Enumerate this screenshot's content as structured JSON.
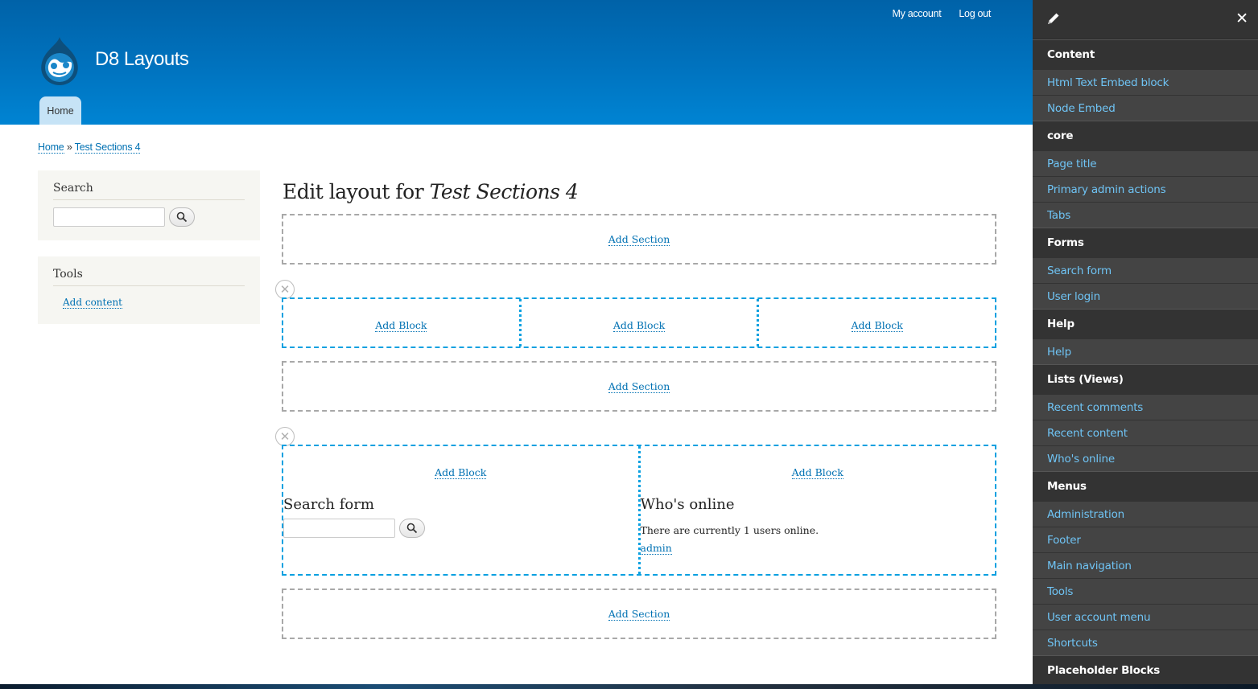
{
  "header": {
    "site_name": "D8 Layouts",
    "secondary_menu": [
      "My account",
      "Log out"
    ],
    "main_menu": [
      "Home"
    ]
  },
  "breadcrumb": {
    "home": "Home",
    "separator": "»",
    "current": "Test Sections 4"
  },
  "sidebar": {
    "search_title": "Search",
    "tools_title": "Tools",
    "tools_link": "Add content"
  },
  "main": {
    "title_prefix": "Edit layout for",
    "title_node": "Test Sections 4",
    "add_section": "Add Section",
    "add_block": "Add Block",
    "remove_symbol": "✕",
    "search_form_title": "Search form",
    "whos_online_title": "Who's online",
    "whos_online_text": "There are currently 1 users online.",
    "whos_online_user": "admin"
  },
  "panel": {
    "close_symbol": "✕",
    "categories": [
      {
        "title": "Content",
        "items": [
          "Html Text Embed block",
          "Node Embed"
        ]
      },
      {
        "title": "core",
        "items": [
          "Page title",
          "Primary admin actions",
          "Tabs"
        ]
      },
      {
        "title": "Forms",
        "items": [
          "Search form",
          "User login"
        ]
      },
      {
        "title": "Help",
        "items": [
          "Help"
        ]
      },
      {
        "title": "Lists (Views)",
        "items": [
          "Recent comments",
          "Recent content",
          "Who's online"
        ]
      },
      {
        "title": "Menus",
        "items": [
          "Administration",
          "Footer",
          "Main navigation",
          "Tools",
          "User account menu",
          "Shortcuts"
        ]
      },
      {
        "title": "Placeholder Blocks",
        "items": []
      }
    ]
  },
  "colors": {
    "link": "#0071b3",
    "header_blue": "#0073bf",
    "panel_bg": "#444444",
    "panel_link": "#6fc4f5",
    "section_border": "#0aa0e0"
  }
}
